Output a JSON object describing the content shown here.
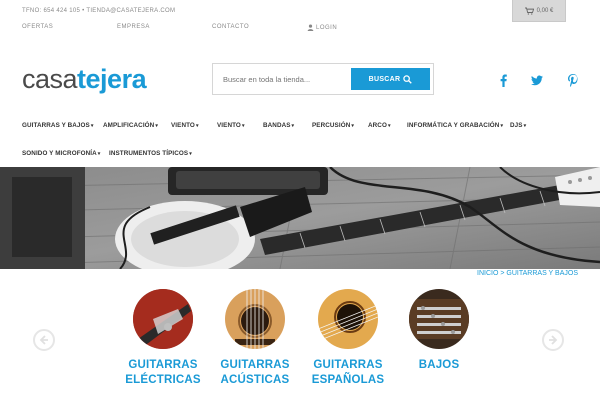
{
  "topbar": {
    "contact": "TFNO: 654 424 105 • TIENDA@CASATEJERA.COM",
    "links": {
      "ofertas": "OFERTAS",
      "empresa": "EMPRESA",
      "contacto": "CONTACTO",
      "login": "LOGIN"
    },
    "cart": "0,00 €"
  },
  "header": {
    "logo_part1": "casa",
    "logo_part2": "tejera",
    "search_placeholder": "Buscar en toda la tienda...",
    "search_button": "BUSCAR",
    "social": [
      "facebook-icon",
      "twitter-icon",
      "pinterest-icon"
    ]
  },
  "nav": {
    "items": [
      "GUITARRAS Y BAJOS",
      "AMPLIFICACIÓN",
      "VIENTO",
      "VIENTO",
      "BANDAS",
      "PERCUSIÓN",
      "ARCO",
      "INFORMÁTICA Y GRABACIÓN",
      "DJS",
      "SONIDO Y MICROFONÍA",
      "INSTRUMENTOS TÍPICOS"
    ],
    "caret": "▾"
  },
  "breadcrumb": {
    "home": "INICIO",
    "separator": ">",
    "current": "GUITARRAS Y BAJOS"
  },
  "categories": [
    {
      "line1": "GUITARRAS",
      "line2": "ELÉCTRICAS"
    },
    {
      "line1": "GUITARRAS",
      "line2": "ACÚSTICAS"
    },
    {
      "line1": "GUITARRAS",
      "line2": "ESPAÑOLAS"
    },
    {
      "line1": "BAJOS",
      "line2": ""
    }
  ],
  "colors": {
    "accent": "#1a9ad6",
    "text": "#333333",
    "muted": "#8a8a8a"
  }
}
